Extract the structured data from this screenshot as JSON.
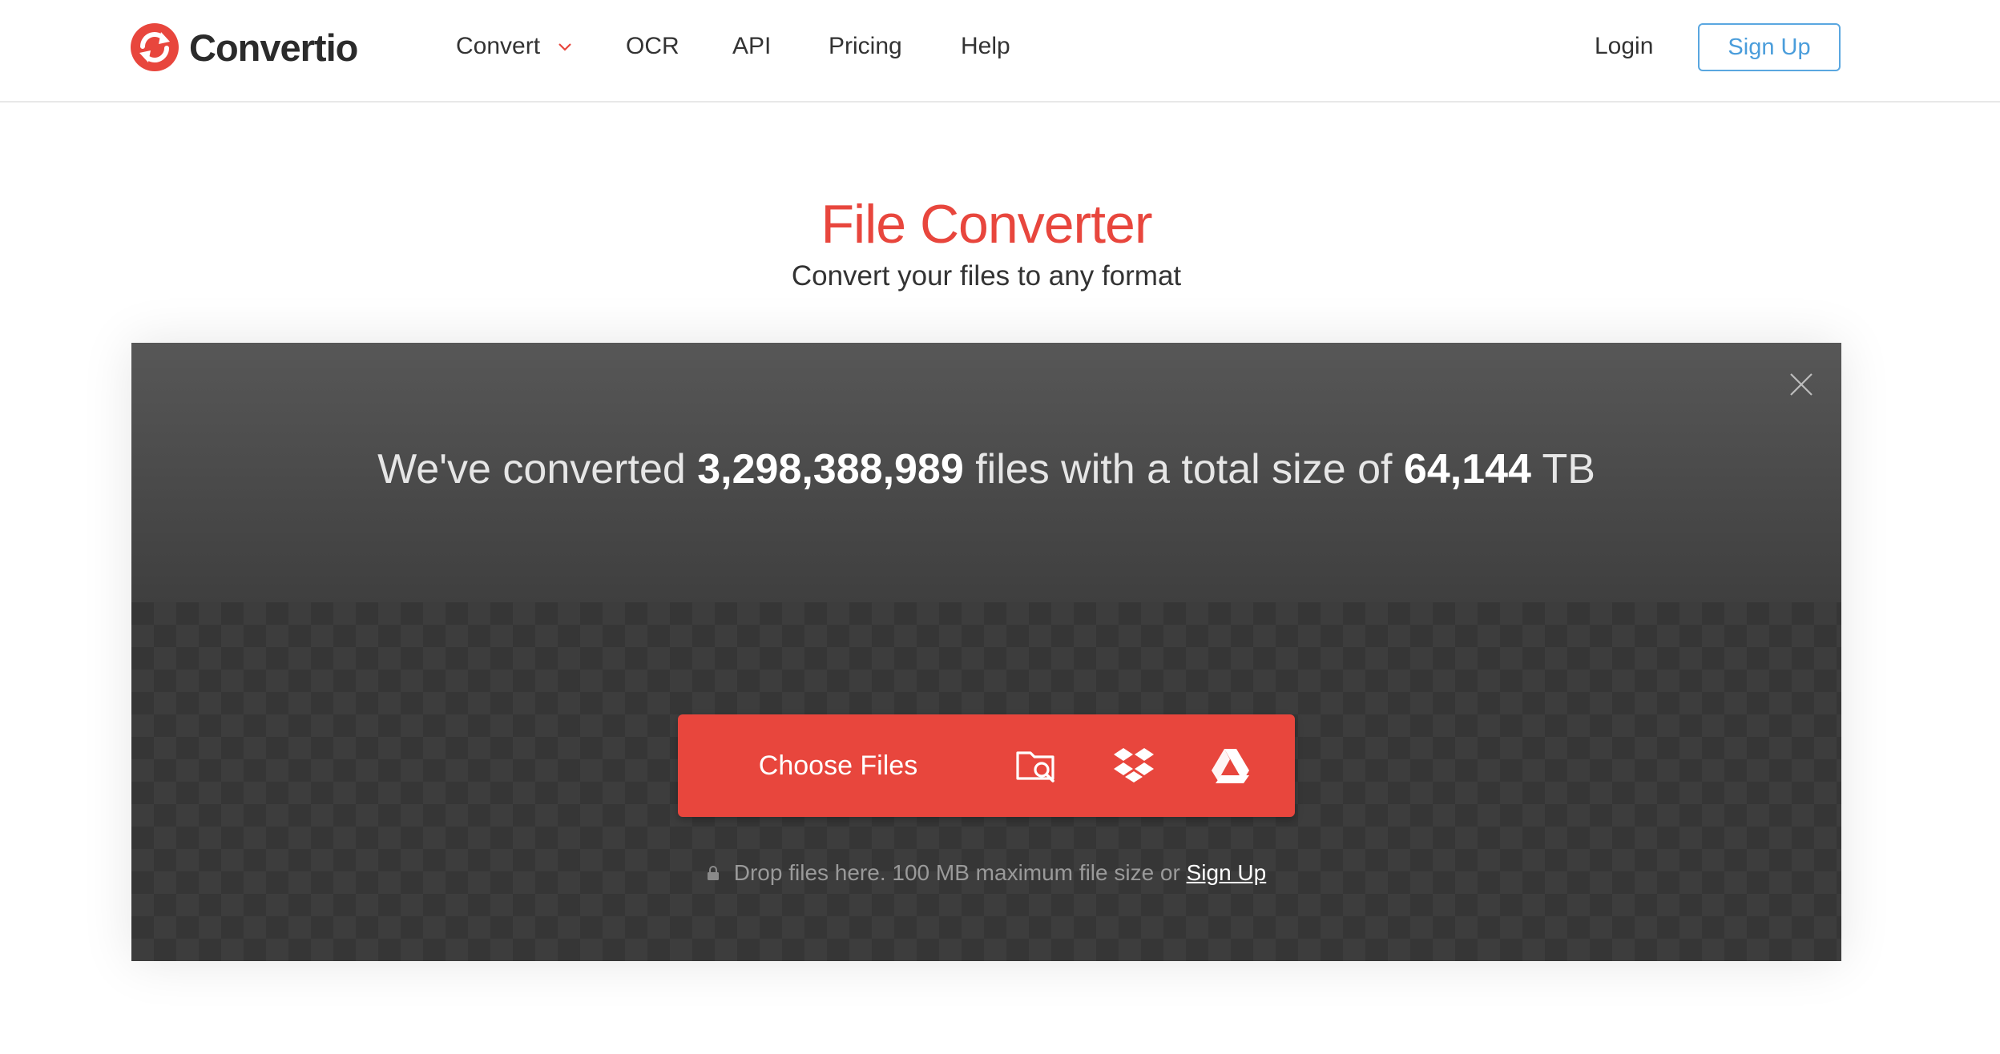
{
  "brand": {
    "name": "Convertio",
    "accent_color": "#e8463d",
    "link_color": "#4a9ddb"
  },
  "nav": {
    "items": [
      {
        "label": "Convert",
        "has_dropdown": true
      },
      {
        "label": "OCR"
      },
      {
        "label": "API"
      },
      {
        "label": "Pricing"
      },
      {
        "label": "Help"
      }
    ],
    "login_label": "Login",
    "signup_label": "Sign Up"
  },
  "hero": {
    "title": "File Converter",
    "subtitle": "Convert your files to any format"
  },
  "stats": {
    "prefix": "We've converted ",
    "files_count": "3,298,388,989",
    "middle": " files with a total size of ",
    "total_size": "64,144",
    "unit": " TB"
  },
  "upload": {
    "choose_files_label": "Choose Files",
    "sources": [
      {
        "icon": "folder-search-icon",
        "name": "From Computer"
      },
      {
        "icon": "dropbox-icon",
        "name": "From Dropbox"
      },
      {
        "icon": "google-drive-icon",
        "name": "From Google Drive"
      }
    ],
    "hint_text": "Drop files here. 100 MB maximum file size or ",
    "hint_link": "Sign Up"
  }
}
